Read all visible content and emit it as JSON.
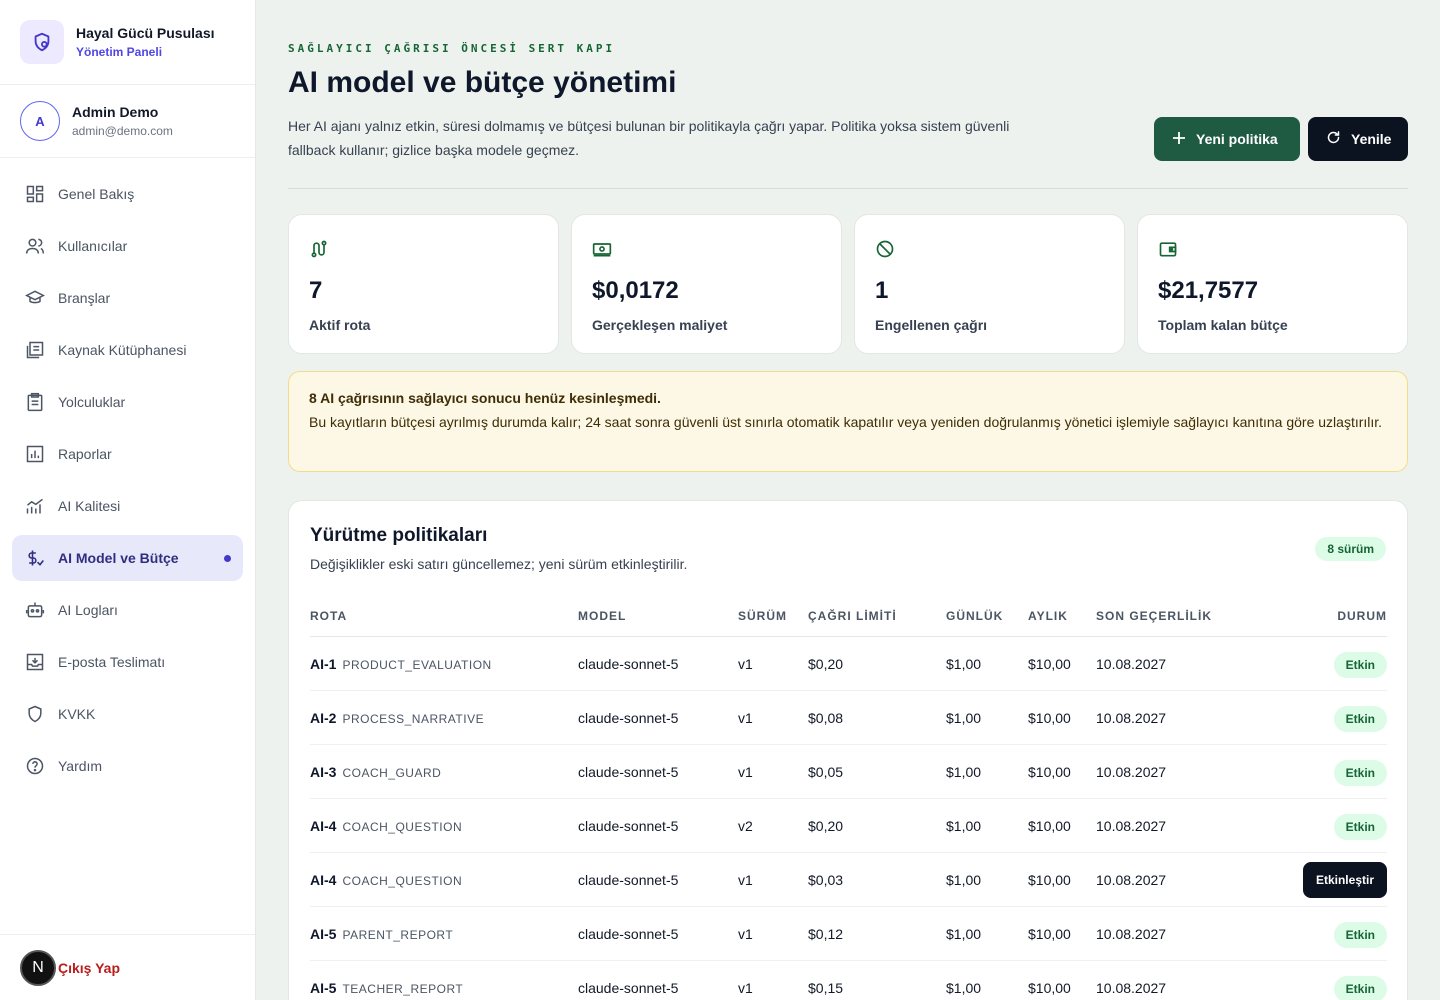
{
  "brand": {
    "title": "Hayal Gücü Pusulası",
    "subtitle": "Yönetim Paneli",
    "icon": "shield-gear-icon"
  },
  "user": {
    "initial": "A",
    "name": "Admin Demo",
    "email": "admin@demo.com"
  },
  "nav": [
    {
      "label": "Genel Bakış",
      "icon": "dashboard-icon"
    },
    {
      "label": "Kullanıcılar",
      "icon": "users-icon"
    },
    {
      "label": "Branşlar",
      "icon": "graduation-cap-icon"
    },
    {
      "label": "Kaynak Kütüphanesi",
      "icon": "library-icon"
    },
    {
      "label": "Yolculuklar",
      "icon": "clipboard-icon"
    },
    {
      "label": "Raporlar",
      "icon": "bar-chart-icon"
    },
    {
      "label": "AI Kalitesi",
      "icon": "trend-chart-icon"
    },
    {
      "label": "AI Model ve Bütçe",
      "icon": "dollar-route-icon",
      "active": true
    },
    {
      "label": "AI Logları",
      "icon": "robot-icon"
    },
    {
      "label": "E-posta Teslimatı",
      "icon": "inbox-icon"
    },
    {
      "label": "KVKK",
      "icon": "shield-icon"
    },
    {
      "label": "Yardım",
      "icon": "help-circle-icon"
    }
  ],
  "logout": {
    "label": "Çıkış Yap",
    "badge": "N"
  },
  "header": {
    "eyebrow": "SAĞLAYICI ÇAĞRISI ÖNCESİ SERT KAPI",
    "title": "AI model ve bütçe yönetimi",
    "description": "Her AI ajanı yalnız etkin, süresi dolmamış ve bütçesi bulunan bir politikayla çağrı yapar. Politika yoksa sistem güvenli fallback kullanır; gizlice başka modele geçmez.",
    "new_policy_label": "Yeni politika",
    "refresh_label": "Yenile"
  },
  "stats": [
    {
      "value": "7",
      "label": "Aktif rota",
      "icon": "route-icon"
    },
    {
      "value": "$0,0172",
      "label": "Gerçekleşen maliyet",
      "icon": "banknote-icon"
    },
    {
      "value": "1",
      "label": "Engellenen çağrı",
      "icon": "ban-icon"
    },
    {
      "value": "$21,7577",
      "label": "Toplam kalan bütçe",
      "icon": "wallet-icon"
    }
  ],
  "alert": {
    "title": "8 AI çağrısının sağlayıcı sonucu henüz kesinleşmedi.",
    "body": "Bu kayıtların bütçesi ayrılmış durumda kalır; 24 saat sonra güvenli üst sınırla otomatik kapatılır veya yeniden doğrulanmış yönetici işlemiyle sağlayıcı kanıtına göre uzlaştırılır."
  },
  "policies": {
    "title": "Yürütme politikaları",
    "subtitle": "Değişiklikler eski satırı güncellemez; yeni sürüm etkinleştirilir.",
    "version_badge": "8 sürüm",
    "columns": {
      "route": "ROTA",
      "model": "MODEL",
      "version": "SÜRÜM",
      "limit": "ÇAĞRI LİMİTİ",
      "daily": "GÜNLÜK",
      "monthly": "AYLIK",
      "valid": "SON GEÇERLİLİK",
      "status": "DURUM"
    },
    "rows": [
      {
        "id": "AI-1",
        "name": "PRODUCT_EVALUATION",
        "model": "claude-sonnet-5",
        "version": "v1",
        "limit": "$0,20",
        "daily": "$1,00",
        "monthly": "$10,00",
        "valid": "10.08.2027",
        "status": "Etkin",
        "action": false
      },
      {
        "id": "AI-2",
        "name": "PROCESS_NARRATIVE",
        "model": "claude-sonnet-5",
        "version": "v1",
        "limit": "$0,08",
        "daily": "$1,00",
        "monthly": "$10,00",
        "valid": "10.08.2027",
        "status": "Etkin",
        "action": false
      },
      {
        "id": "AI-3",
        "name": "COACH_GUARD",
        "model": "claude-sonnet-5",
        "version": "v1",
        "limit": "$0,05",
        "daily": "$1,00",
        "monthly": "$10,00",
        "valid": "10.08.2027",
        "status": "Etkin",
        "action": false
      },
      {
        "id": "AI-4",
        "name": "COACH_QUESTION",
        "model": "claude-sonnet-5",
        "version": "v2",
        "limit": "$0,20",
        "daily": "$1,00",
        "monthly": "$10,00",
        "valid": "10.08.2027",
        "status": "Etkin",
        "action": false
      },
      {
        "id": "AI-4",
        "name": "COACH_QUESTION",
        "model": "claude-sonnet-5",
        "version": "v1",
        "limit": "$0,03",
        "daily": "$1,00",
        "monthly": "$10,00",
        "valid": "10.08.2027",
        "status": "Etkinleştir",
        "action": true
      },
      {
        "id": "AI-5",
        "name": "PARENT_REPORT",
        "model": "claude-sonnet-5",
        "version": "v1",
        "limit": "$0,12",
        "daily": "$1,00",
        "monthly": "$10,00",
        "valid": "10.08.2027",
        "status": "Etkin",
        "action": false
      },
      {
        "id": "AI-5",
        "name": "TEACHER_REPORT",
        "model": "claude-sonnet-5",
        "version": "v1",
        "limit": "$0,15",
        "daily": "$1,00",
        "monthly": "$10,00",
        "valid": "10.08.2027",
        "status": "Etkin",
        "action": false
      }
    ]
  },
  "colors": {
    "accent": "#1f5b43",
    "brand": "#4338ca",
    "dark_button": "#0b1220",
    "alert_bg": "#fdf8e6",
    "success_bg": "#dcfce7",
    "success_text": "#166534",
    "danger": "#b91c1c"
  }
}
